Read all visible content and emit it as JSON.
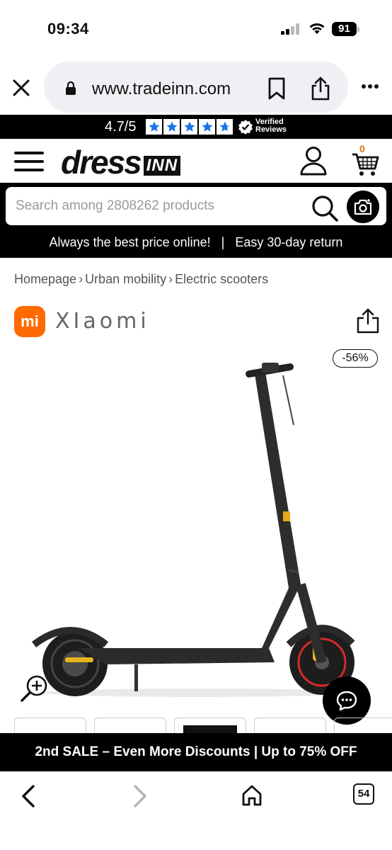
{
  "status_bar": {
    "time": "09:34",
    "battery": "91",
    "icons": [
      "cellular-signal-icon",
      "wifi-icon",
      "battery-icon"
    ]
  },
  "browser": {
    "url": "www.tradeinn.com",
    "icons": [
      "close-icon",
      "lock-icon",
      "bookmark-icon",
      "share-icon",
      "more-icon"
    ]
  },
  "rating": {
    "score": "4.7/5",
    "stars": 4.7,
    "verified_line1": "Verified",
    "verified_line2": "Reviews",
    "star_color": "#1a73e8"
  },
  "header": {
    "logo_main": "dress",
    "logo_suffix": "INN",
    "cart_count": "0",
    "cart_count_color": "#e07000"
  },
  "search": {
    "placeholder": "Search among 2808262 products"
  },
  "promo": {
    "text": "Always the best price online!   |   Easy 30-day return"
  },
  "breadcrumb": {
    "items": [
      "Homepage",
      "Urban mobility",
      "Electric scooters"
    ]
  },
  "brand": {
    "logo_text": "mi",
    "name": "XIaomi",
    "logo_color": "#ff6a00"
  },
  "product": {
    "discount": "-56%"
  },
  "sale_banner": {
    "text": "2nd SALE – Even More Discounts | Up to 75% OFF"
  },
  "bottom_nav": {
    "tab_count": "54"
  }
}
